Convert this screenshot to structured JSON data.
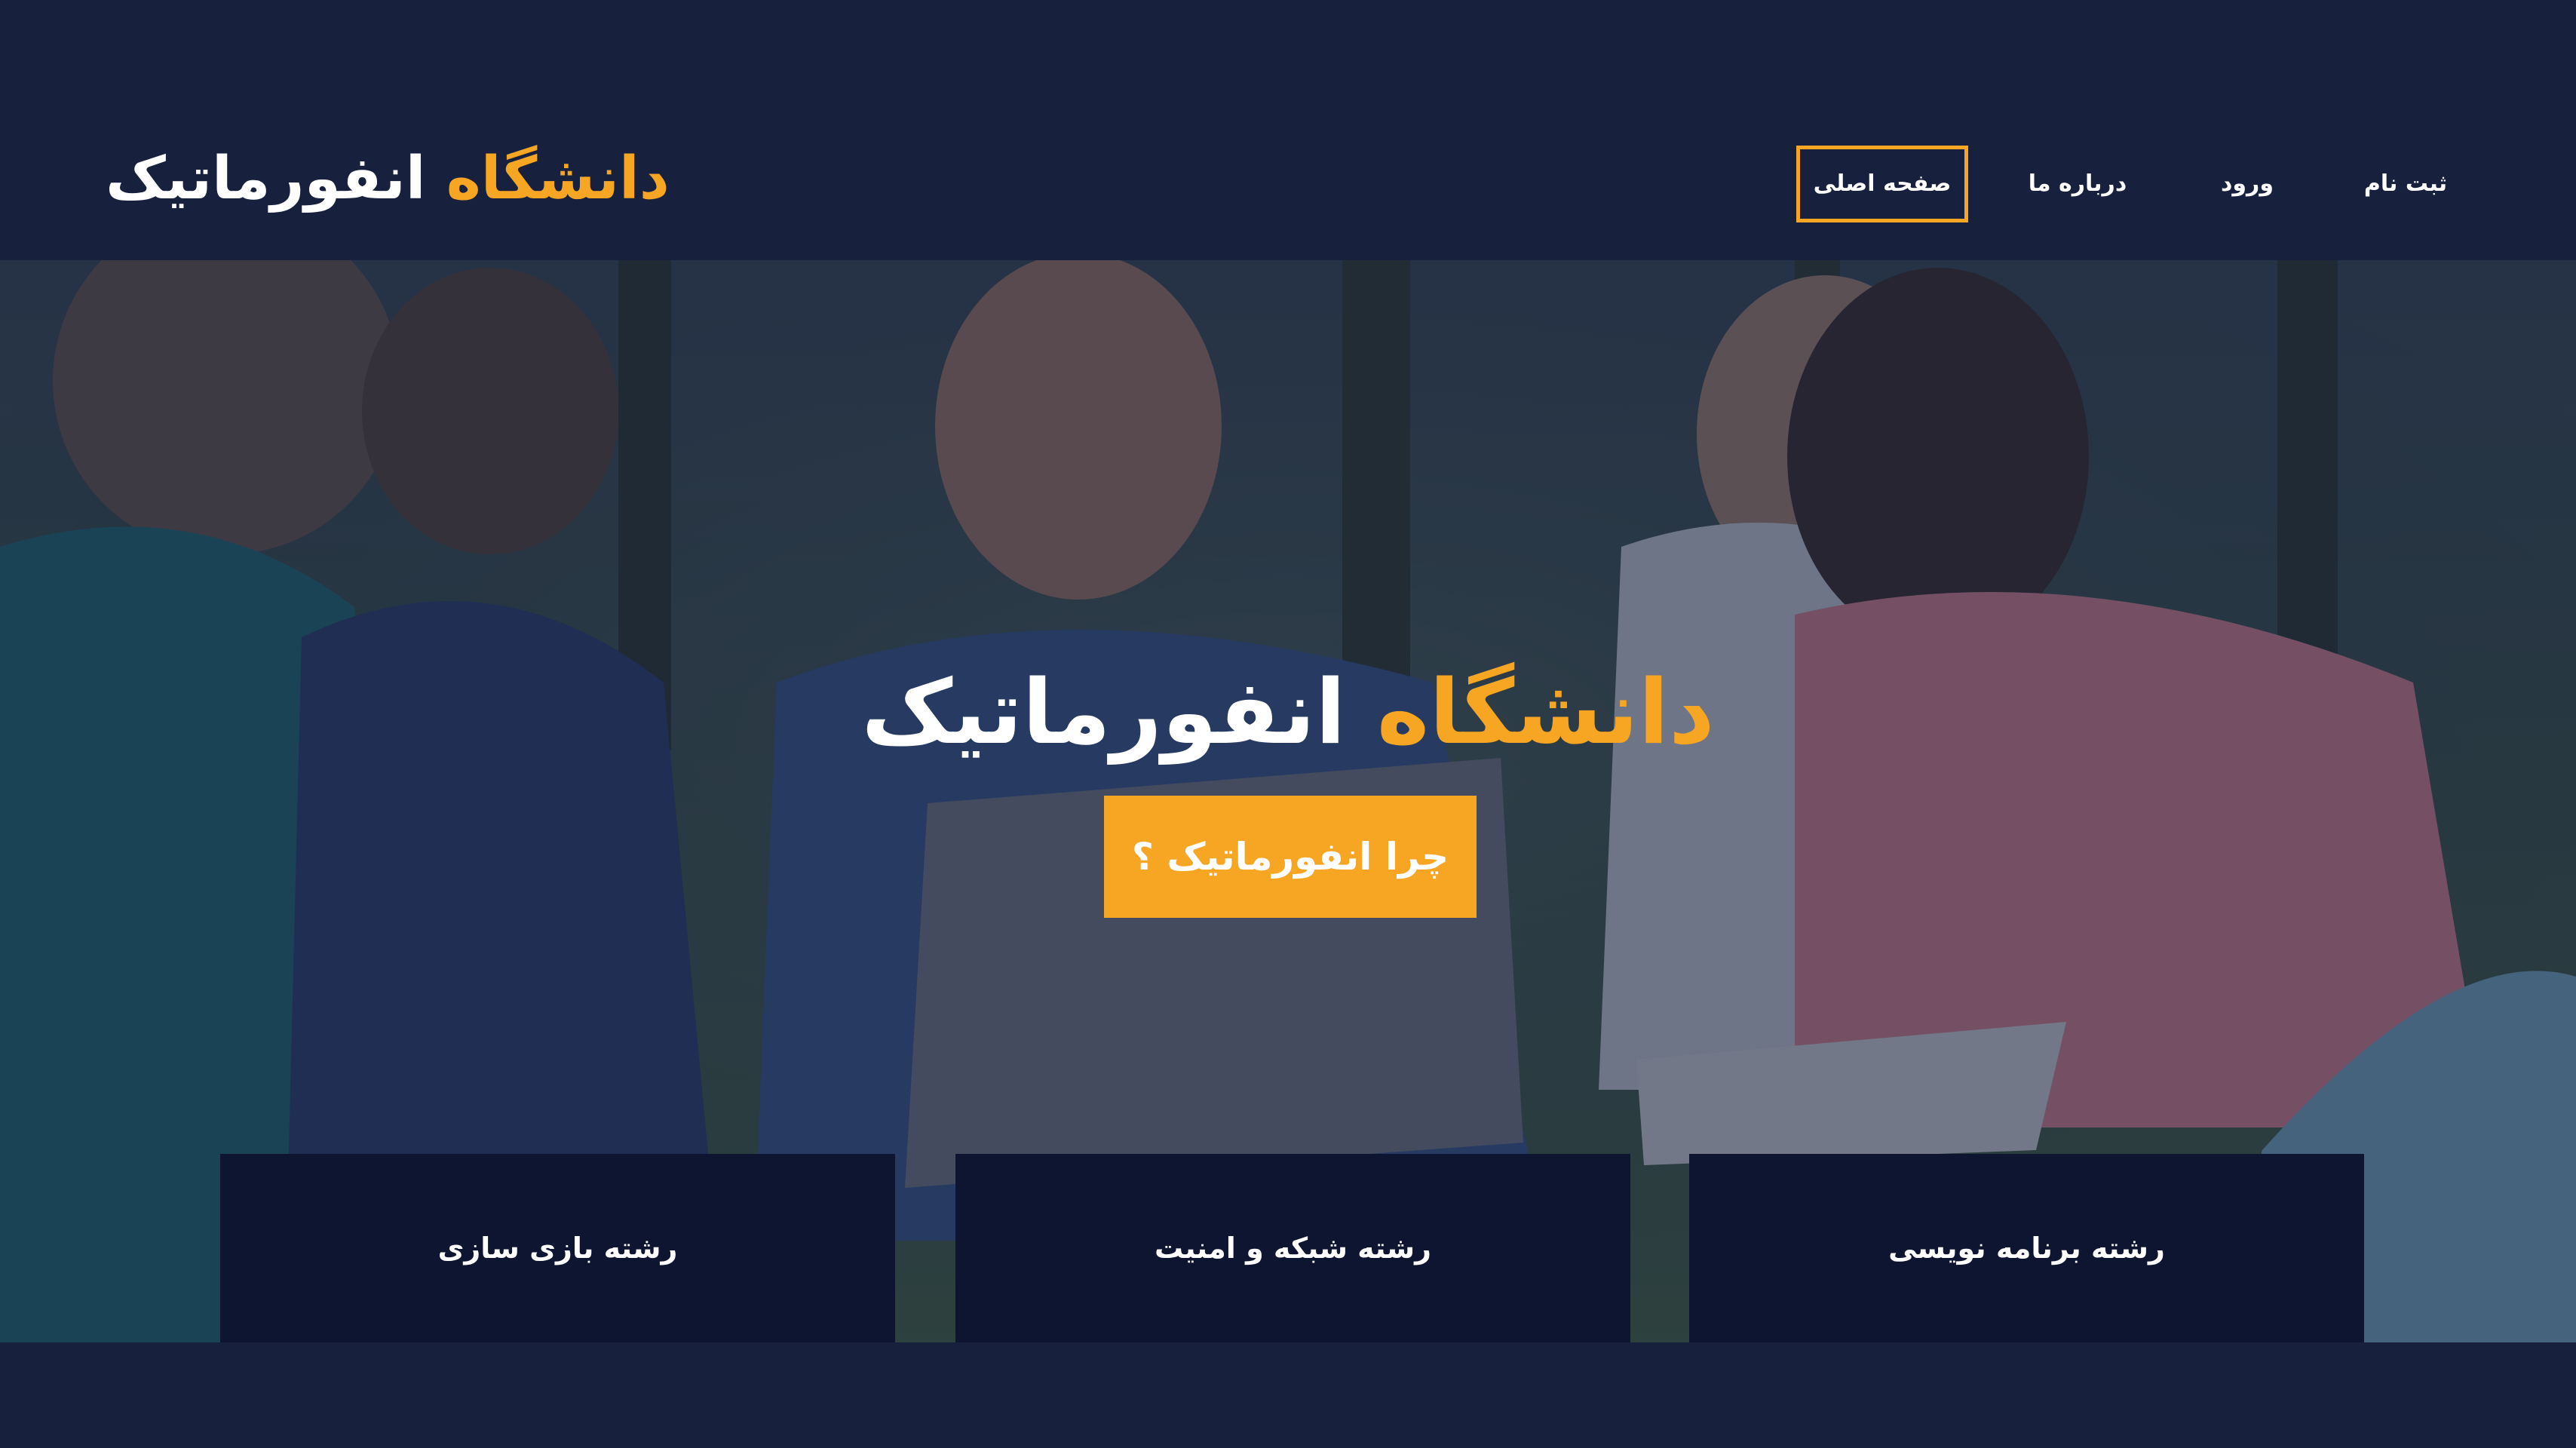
{
  "logo": {
    "accent_word": "دانشگاه",
    "light_word": "انفورماتیک"
  },
  "nav": {
    "items": [
      {
        "label": "ثبت نام"
      },
      {
        "label": "ورود"
      },
      {
        "label": "درباره ما"
      },
      {
        "label": "صفحه اصلی",
        "active": true
      }
    ]
  },
  "hero": {
    "title_accent": "دانشگاه",
    "title_light": "انفورماتیک",
    "cta_label": "چرا انفورماتیک ؟"
  },
  "cards": [
    {
      "label": "رشته برنامه نویسی"
    },
    {
      "label": "رشته شبکه و امنیت"
    },
    {
      "label": "رشته بازی سازی"
    }
  ],
  "colors": {
    "accent": "#f6a623",
    "background": "#17213e",
    "card": "#0e1530"
  }
}
